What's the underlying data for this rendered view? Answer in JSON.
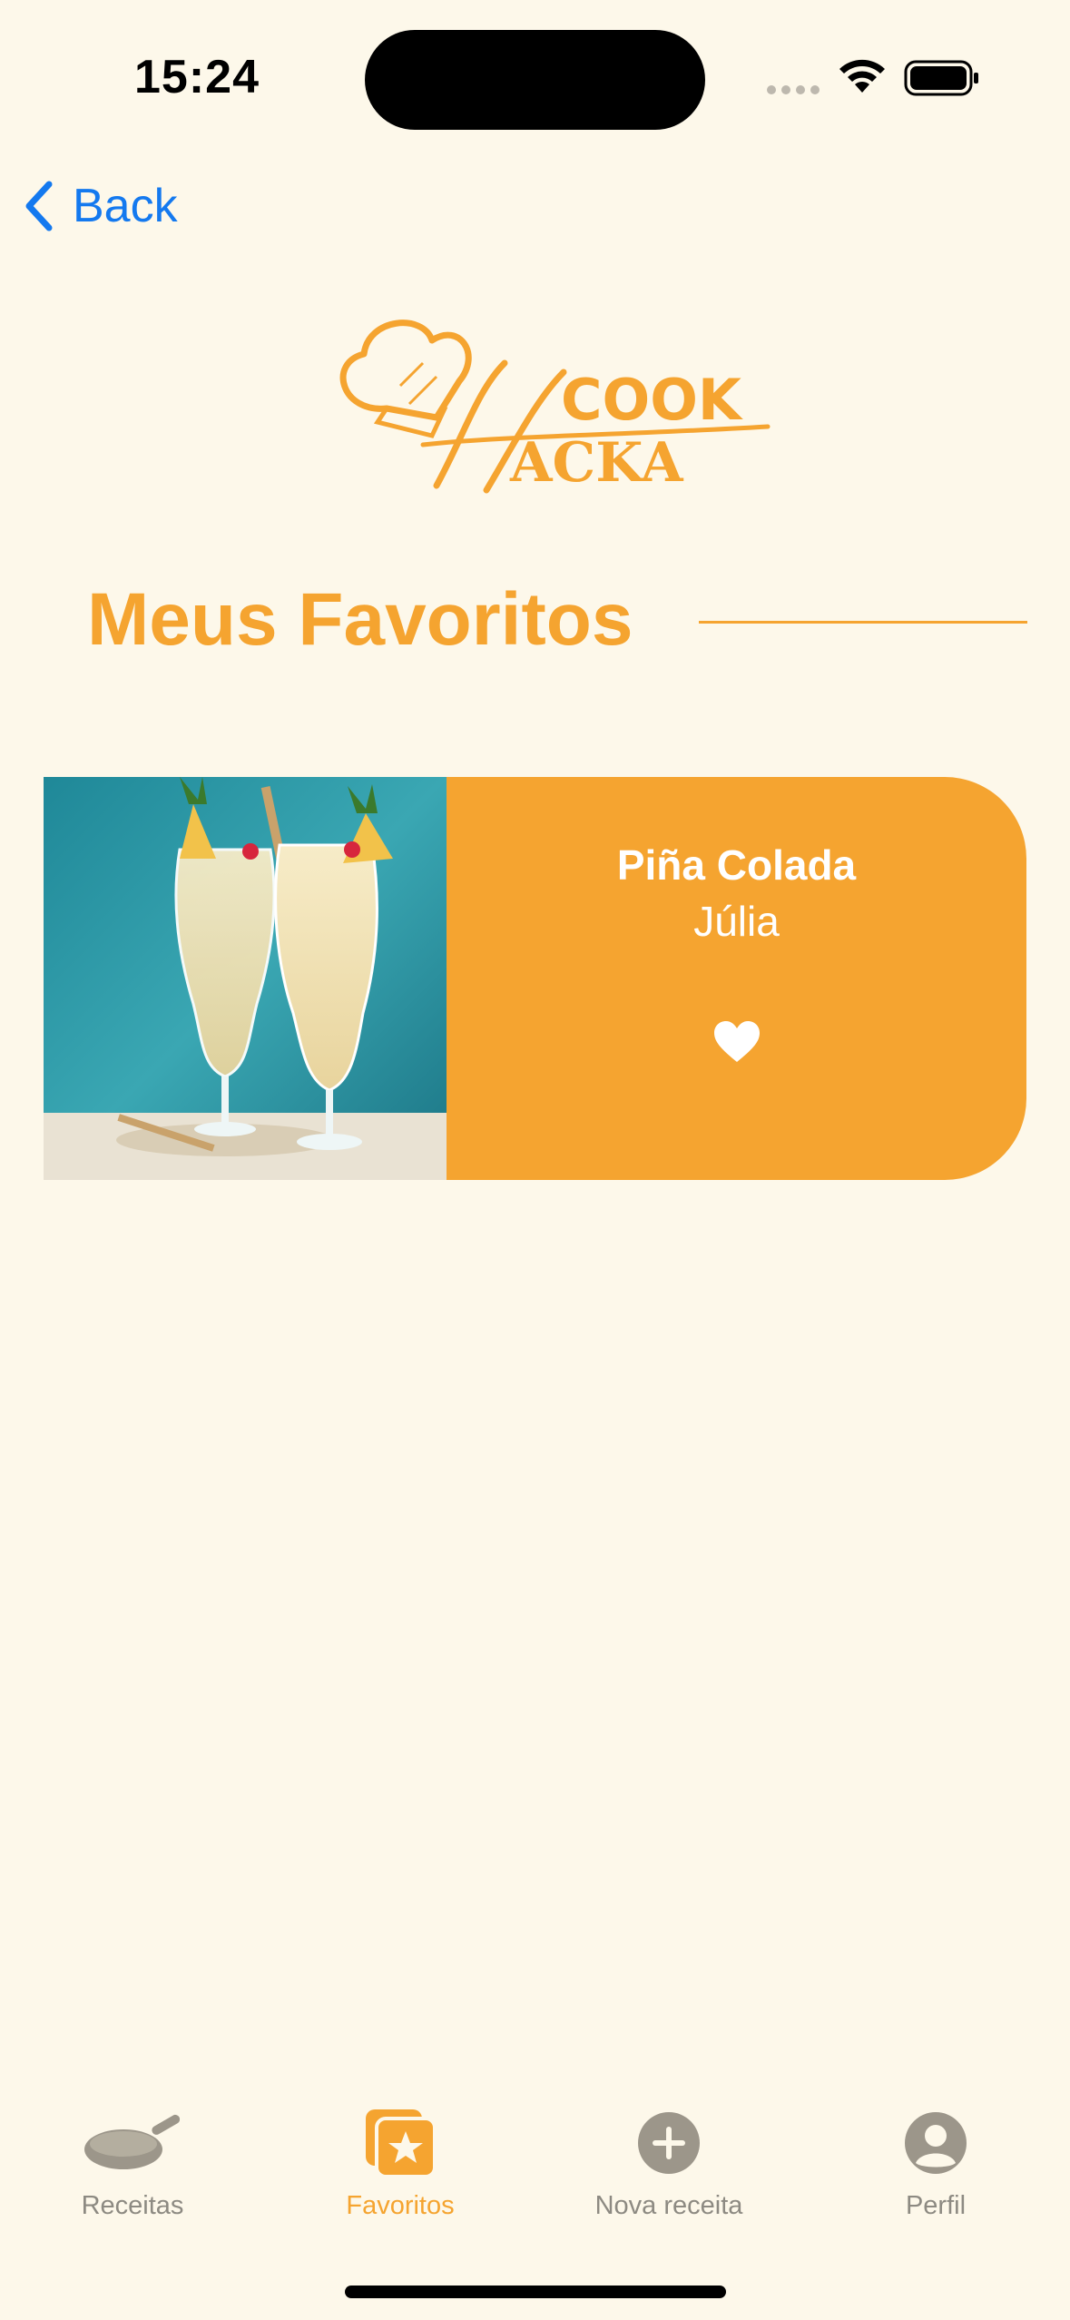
{
  "status_bar": {
    "time": "15:24"
  },
  "nav": {
    "back_label": "Back"
  },
  "logo": {
    "word_top": "COOK",
    "word_main": "ACKA",
    "initial": "H"
  },
  "page": {
    "title": "Meus Favoritos"
  },
  "favorites": [
    {
      "name": "Piña Colada",
      "author": "Júlia",
      "favorited": true
    }
  ],
  "tabbar": {
    "items": [
      {
        "label": "Receitas",
        "icon": "frying-pan-icon",
        "active": false
      },
      {
        "label": "Favoritos",
        "icon": "favorites-star-icon",
        "active": true
      },
      {
        "label": "Nova receita",
        "icon": "plus-circle-icon",
        "active": false
      },
      {
        "label": "Perfil",
        "icon": "person-circle-icon",
        "active": false
      }
    ]
  },
  "colors": {
    "background": "#fdf8ea",
    "accent": "#f5a430",
    "link": "#1479ef",
    "inactive": "#8d8a82"
  }
}
